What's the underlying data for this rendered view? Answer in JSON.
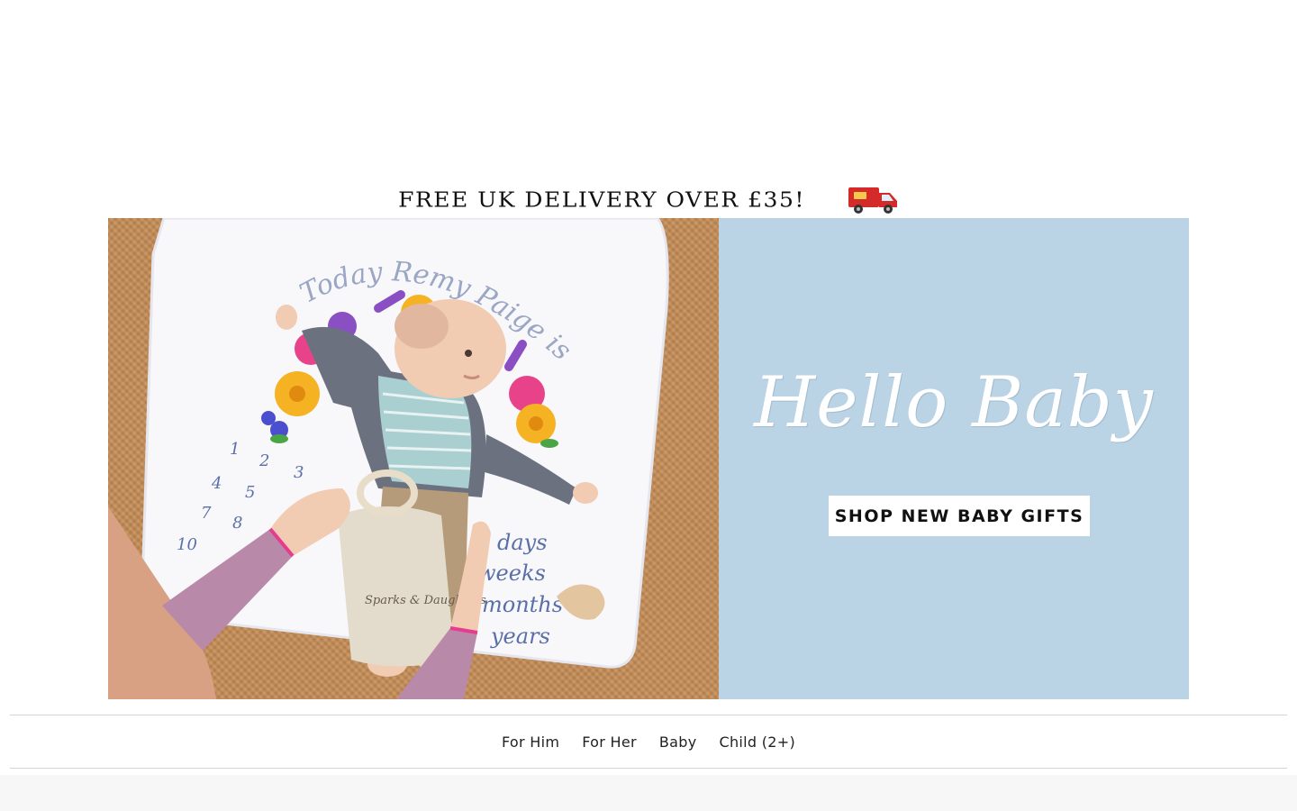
{
  "promo": {
    "delivery_text": "FREE UK DELIVERY OVER £35!",
    "van_icon": "delivery-van-icon"
  },
  "hero": {
    "title": "Hello Baby",
    "cta_label": "SHOP NEW BABY GIFTS",
    "panel_color": "#bad3e5",
    "blanket": {
      "arch_text": "Today Remy Paige is",
      "numbers": [
        "1",
        "2",
        "3",
        "4",
        "5",
        "7",
        "8",
        "10"
      ],
      "units": [
        "days",
        "weeks",
        "months",
        "years"
      ]
    },
    "bag_label": "Sparks & Daughters"
  },
  "category_nav": {
    "items": [
      {
        "label": "For Him"
      },
      {
        "label": "For Her"
      },
      {
        "label": "Baby"
      },
      {
        "label": "Child (2+)"
      }
    ]
  }
}
